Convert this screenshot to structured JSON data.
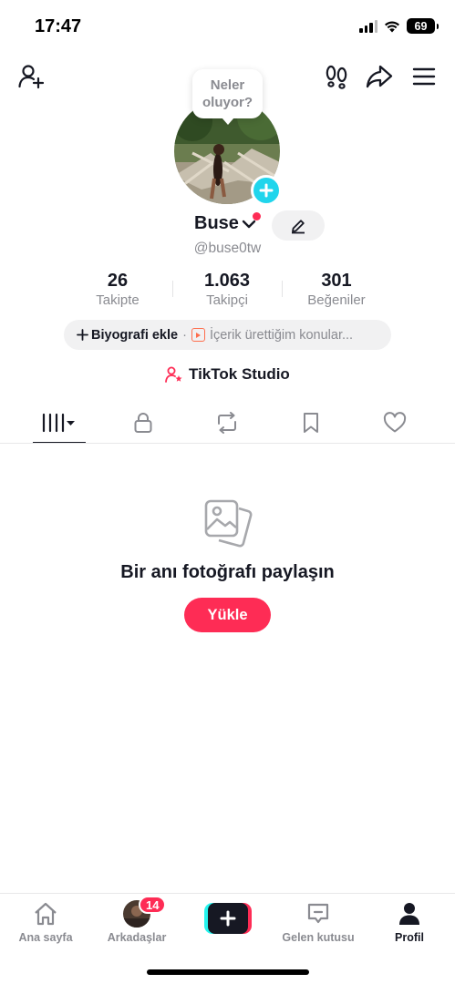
{
  "status_bar": {
    "time": "17:47",
    "battery": "69"
  },
  "top_bar": {
    "icons": [
      "add-friend-icon",
      "footprints-icon",
      "share-icon",
      "menu-icon"
    ]
  },
  "story_bubble": {
    "text": "Neler oluyor?"
  },
  "profile": {
    "name": "Buse",
    "handle": "@buse0tw",
    "stats": [
      {
        "value": "26",
        "label": "Takipte"
      },
      {
        "value": "1.063",
        "label": "Takipçi"
      },
      {
        "value": "301",
        "label": "Beğeniler"
      }
    ],
    "bio": {
      "add_label": "Biyografi ekle",
      "separator": "·",
      "topics_label": "İçerik ürettiğim konular..."
    },
    "studio_label": "TikTok Studio"
  },
  "tabs": [
    "videos-grid-icon",
    "lock-icon",
    "repost-icon",
    "bookmark-icon",
    "heart-icon"
  ],
  "empty_state": {
    "title": "Bir anı fotoğrafı paylaşın",
    "button": "Yükle"
  },
  "bottom_nav": {
    "home": "Ana sayfa",
    "friends": "Arkadaşlar",
    "friends_badge": "14",
    "inbox": "Gelen kutusu",
    "profile": "Profil"
  },
  "colors": {
    "accent": "#fe2c55",
    "cyan": "#20d5ec",
    "text": "#161823",
    "muted": "#8a8b91"
  }
}
